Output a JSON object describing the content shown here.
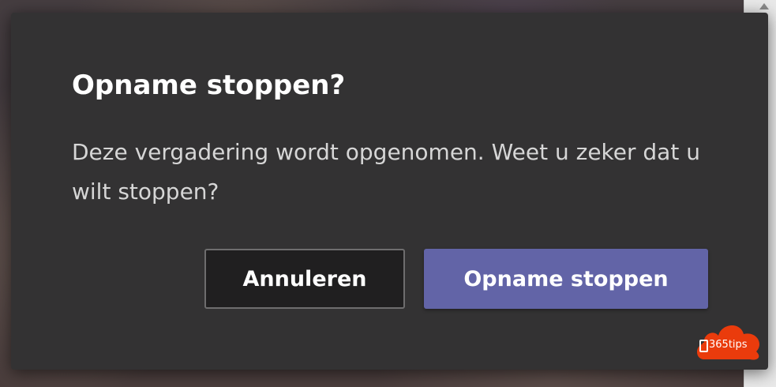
{
  "dialog": {
    "title": "Opname stoppen?",
    "message": "Deze vergadering wordt opgenomen. Weet u zeker dat u wilt stoppen?",
    "cancel_label": "Annuleren",
    "confirm_label": "Opname stoppen"
  },
  "watermark": {
    "text": "365tips",
    "icon": "office-cloud-icon"
  },
  "colors": {
    "accent": "#6264a7",
    "dialog_bg": "#333233",
    "cancel_bg": "#201f20",
    "badge": "#ea3b0c"
  }
}
